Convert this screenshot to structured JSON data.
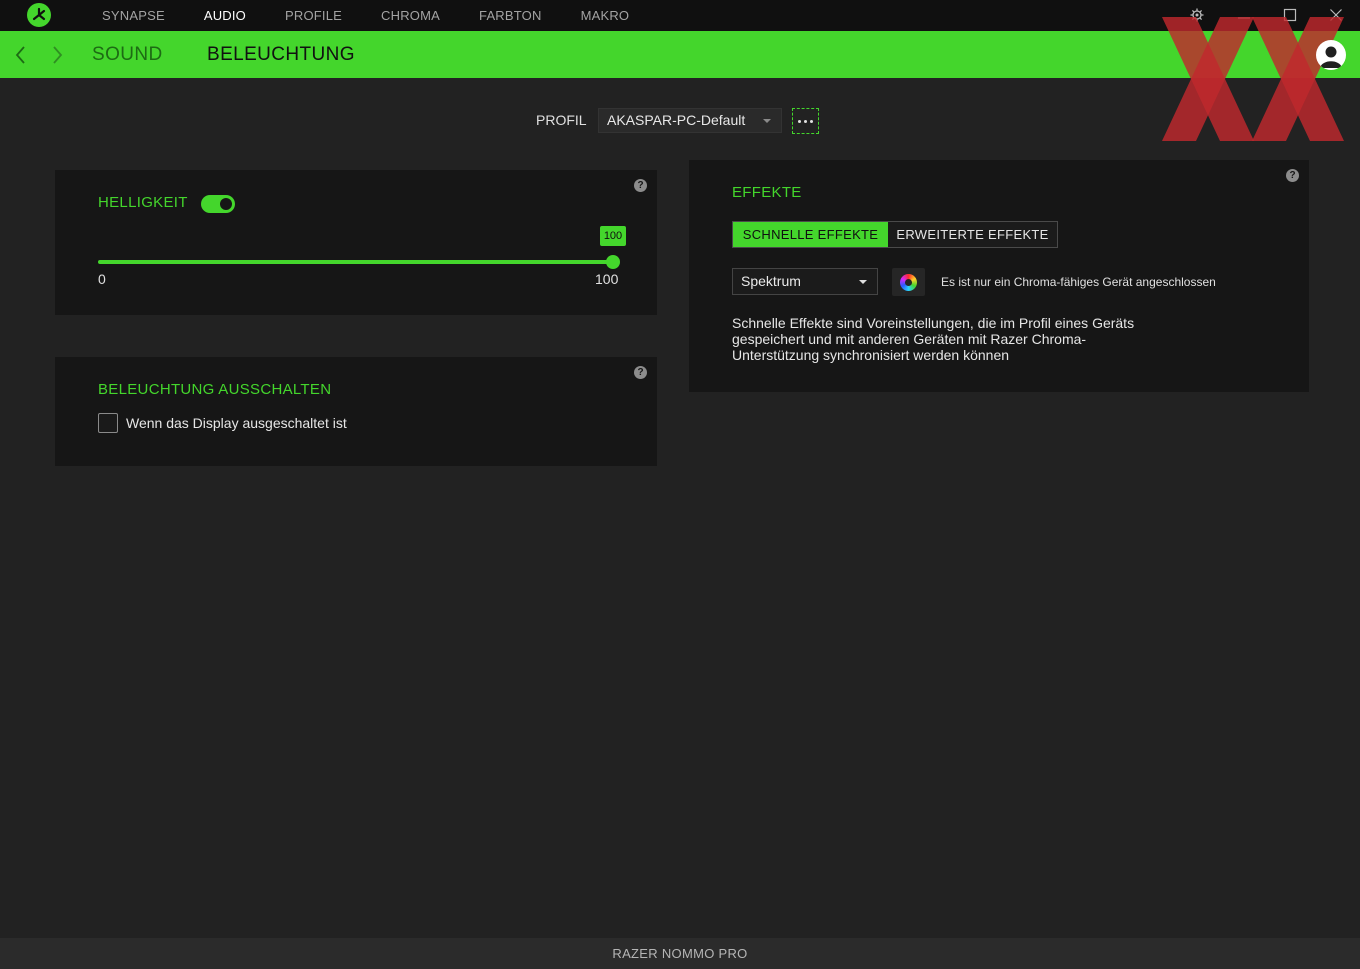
{
  "topnav": {
    "items": [
      {
        "label": "SYNAPSE"
      },
      {
        "label": "AUDIO"
      },
      {
        "label": "PROFILE"
      },
      {
        "label": "CHROMA"
      },
      {
        "label": "FARBTON"
      },
      {
        "label": "MAKRO"
      }
    ],
    "active_index": 1
  },
  "subnav": {
    "tabs": [
      {
        "label": "SOUND"
      },
      {
        "label": "BELEUCHTUNG"
      }
    ],
    "active_index": 1
  },
  "profile": {
    "label": "PROFIL",
    "selected": "AKASPAR-PC-Default"
  },
  "brightness": {
    "title": "HELLIGKEIT",
    "enabled": true,
    "value": "100",
    "value_fraction": 1.0,
    "min_label": "0",
    "max_label": "100"
  },
  "lighting_off": {
    "title": "BELEUCHTUNG AUSSCHALTEN",
    "checkbox_label": "Wenn das Display ausgeschaltet ist",
    "checked": false
  },
  "effects": {
    "title": "EFFEKTE",
    "tabs": [
      {
        "label": "SCHNELLE EFFEKTE"
      },
      {
        "label": "ERWEITERTE EFFEKTE"
      }
    ],
    "active_tab_index": 0,
    "selected_effect": "Spektrum",
    "chroma_note": "Es ist nur ein Chroma-fähiges Gerät angeschlossen",
    "description": "Schnelle Effekte sind Voreinstellungen, die im Profil eines Geräts gespeichert und mit anderen Geräten mit Razer Chroma-Unterstützung synchronisiert werden können"
  },
  "help_glyph": "?",
  "footer": {
    "device_name": "RAZER NOMMO PRO"
  },
  "colors": {
    "accent": "#44d62c",
    "background": "#222222",
    "panel": "#161616",
    "topbar": "#101010"
  },
  "icons": {
    "logo": "razer-snake-icon",
    "settings": "gear-icon",
    "minimize": "minimize-icon",
    "maximize": "maximize-icon",
    "close": "close-icon",
    "back": "chevron-left-icon",
    "forward": "chevron-right-icon",
    "user": "user-avatar-icon",
    "color": "color-wheel-icon",
    "help": "help-icon"
  }
}
